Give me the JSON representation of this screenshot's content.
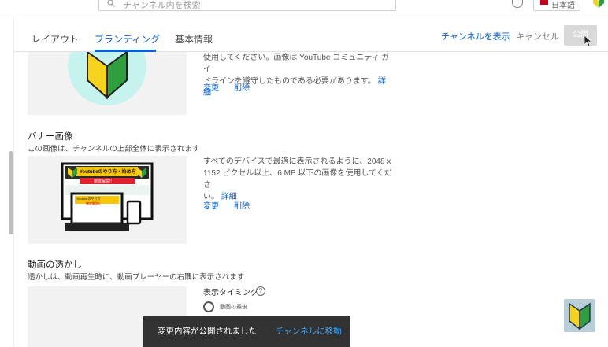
{
  "topbar": {
    "search_placeholder": "チャンネル内を検索",
    "language_label": "日本語"
  },
  "tabs": [
    {
      "label": "レイアウト"
    },
    {
      "label": "ブランディング",
      "active": true
    },
    {
      "label": "基本情報"
    }
  ],
  "header_actions": {
    "view_channel": "チャンネルを表示",
    "cancel": "キャンセル",
    "publish": "公開"
  },
  "profile_picture": {
    "description_line1": "使用してください。画像は YouTube コミュニティ ガイ",
    "description_line2": "ドラインを遵守したものである必要があります。",
    "details_link": "詳細",
    "change": "変更",
    "remove": "削除"
  },
  "banner_image": {
    "title": "バナー画像",
    "subtitle": "この画像は、チャンネルの上部全体に表示されます",
    "description_line1": "すべてのデバイスで最適に表示されるように、2048 x",
    "description_line2": "1152 ピクセル以上、6 MB 以下の画像を使用してくださ",
    "description_line3": "い。",
    "details_link": "詳細",
    "change": "変更",
    "remove": "削除",
    "preview_title": "Youtubeのやり方・始め方",
    "preview_subtitle": "徹底解説!!",
    "preview_small_title": "Youtubeのやり方",
    "preview_small_subtitle": "徹底解説!!"
  },
  "watermark": {
    "title": "動画の透かし",
    "subtitle": "透かしは、動画再生時に、動画プレーヤーの右隅に表示されます",
    "display_timing_label": "表示タイミング",
    "option_end_of_video": "動画の最後"
  },
  "snackbar": {
    "message": "変更内容が公開されました",
    "action": "チャンネルに移動"
  },
  "colors": {
    "accent": "#065fd4",
    "snackbar_bg": "#323232",
    "snackbar_action": "#3ea6ff",
    "logo_green": "#2e9e3e",
    "logo_yellow": "#f5d21c"
  }
}
